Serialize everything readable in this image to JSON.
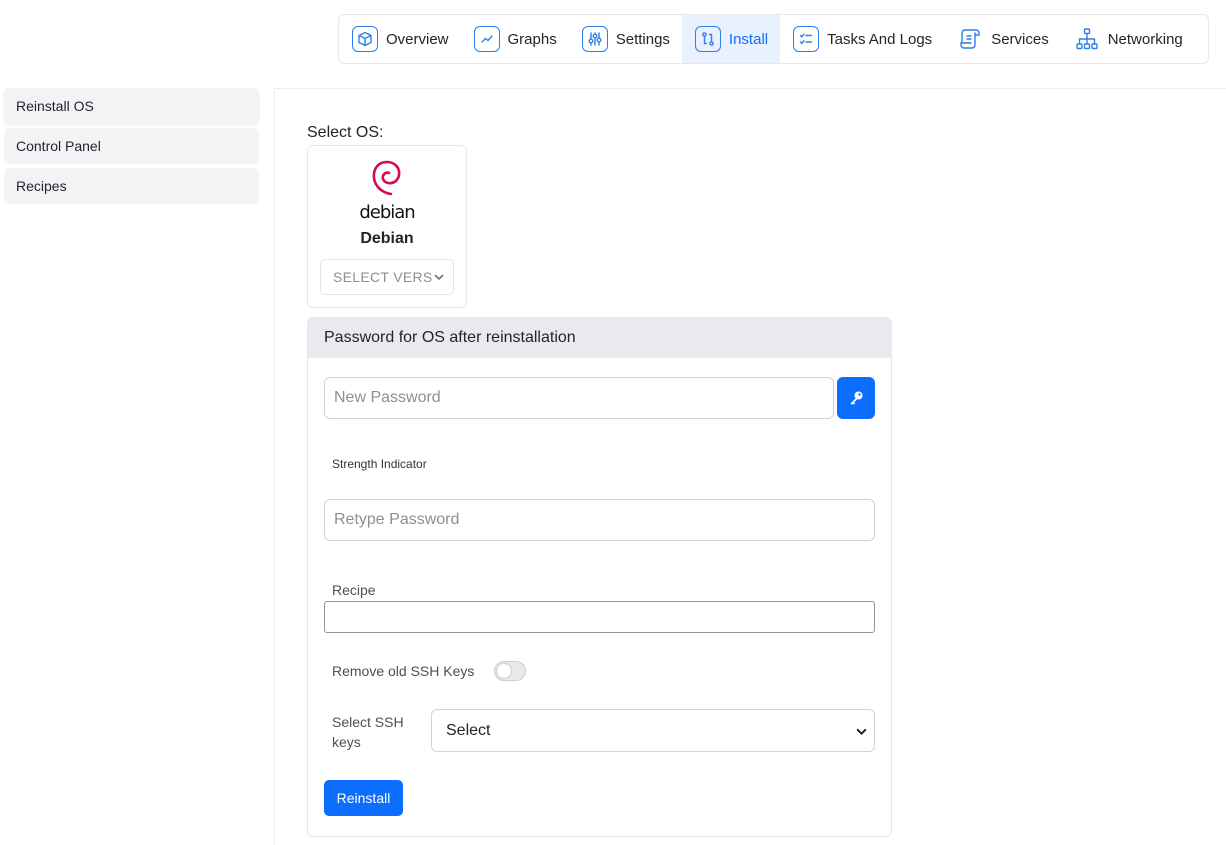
{
  "nav": {
    "items": [
      {
        "label": "Overview",
        "icon": "cube-icon"
      },
      {
        "label": "Graphs",
        "icon": "chart-line-icon"
      },
      {
        "label": "Settings",
        "icon": "sliders-icon"
      },
      {
        "label": "Install",
        "icon": "git-compare-icon",
        "active": true
      },
      {
        "label": "Tasks And Logs",
        "icon": "checklist-icon"
      },
      {
        "label": "Services",
        "icon": "scroll-icon"
      },
      {
        "label": "Networking",
        "icon": "network-icon"
      }
    ]
  },
  "sidebar": {
    "items": [
      {
        "label": "Reinstall OS",
        "active": true
      },
      {
        "label": "Control Panel"
      },
      {
        "label": "Recipes"
      }
    ]
  },
  "os": {
    "select_label": "Select OS:",
    "logo_word": "debian",
    "name": "Debian",
    "version_placeholder": "SELECT VERS"
  },
  "password_panel": {
    "title": "Password for OS after reinstallation",
    "new_password_placeholder": "New Password",
    "strength_label": "Strength Indicator",
    "retype_placeholder": "Retype Password",
    "recipe_label": "Recipe",
    "recipe_value": "",
    "remove_ssh_label": "Remove old SSH Keys",
    "remove_ssh_enabled": false,
    "select_ssh_label": "Select SSH keys",
    "select_ssh_value": "Select",
    "reinstall_label": "Reinstall"
  },
  "colors": {
    "accent": "#0d6efd",
    "debian_red": "#d70a53"
  }
}
